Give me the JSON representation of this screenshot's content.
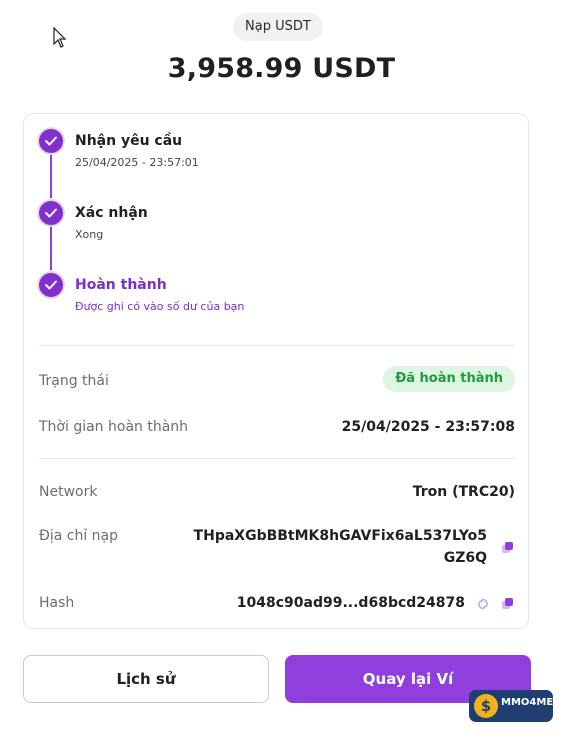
{
  "header": {
    "badge": "Nạp USDT",
    "amount": "3,958.99 USDT"
  },
  "timeline": [
    {
      "title": "Nhận yêu cầu",
      "subtitle": "25/04/2025 - 23:57:01"
    },
    {
      "title": "Xác nhận",
      "subtitle": "Xong"
    },
    {
      "title": "Hoàn thành",
      "subtitle": "Được ghi có vào số dư của bạn"
    }
  ],
  "details": {
    "status_label": "Trạng thái",
    "status_value": "Đã hoàn thành",
    "completed_time_label": "Thời gian hoàn thành",
    "completed_time_value": "25/04/2025 - 23:57:08",
    "network_label": "Network",
    "network_value": "Tron (TRC20)",
    "address_label": "Địa chỉ nạp",
    "address_line1": "THpaXGbBBtMK8hGAVFix6aL537LYo5",
    "address_line2": "GZ6Q",
    "hash_label": "Hash",
    "hash_value": "1048c90ad99...d68bcd24878"
  },
  "buttons": {
    "history": "Lịch sử",
    "back_to_wallet": "Quay lại Ví"
  },
  "watermark": {
    "text": "MMO4ME",
    "coin_symbol": "$"
  },
  "colors": {
    "accent": "#8f3fdb",
    "status_bg": "#dff5e4",
    "status_text": "#1f9a3e"
  }
}
